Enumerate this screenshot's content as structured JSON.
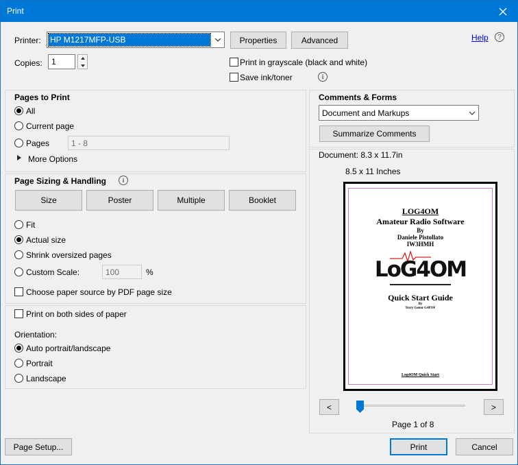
{
  "window": {
    "title": "Print"
  },
  "printer": {
    "label": "Printer:",
    "selected": "HP M1217MFP-USB",
    "properties_label": "Properties",
    "advanced_label": "Advanced",
    "help_label": "Help",
    "copies_label": "Copies:",
    "copies_value": "1",
    "grayscale_label": "Print in grayscale (black and white)",
    "grayscale_checked": false,
    "save_ink_label": "Save ink/toner",
    "save_ink_checked": false
  },
  "pages_to_print": {
    "heading": "Pages to Print",
    "all_label": "All",
    "current_label": "Current page",
    "pages_label": "Pages",
    "pages_value": "1 - 8",
    "more_options_label": "More Options",
    "selected": "All"
  },
  "sizing": {
    "heading": "Page Sizing & Handling",
    "tabs": [
      {
        "label": "Size"
      },
      {
        "label": "Poster"
      },
      {
        "label": "Multiple"
      },
      {
        "label": "Booklet"
      }
    ],
    "fit_label": "Fit",
    "actual_label": "Actual size",
    "shrink_label": "Shrink oversized pages",
    "custom_label": "Custom Scale:",
    "custom_value": "100",
    "percent": "%",
    "paper_source_label": "Choose paper source by PDF page size",
    "selected": "Actual size"
  },
  "duplex": {
    "both_sides_label": "Print on both sides of paper",
    "orientation_label": "Orientation:",
    "auto_label": "Auto portrait/landscape",
    "portrait_label": "Portrait",
    "landscape_label": "Landscape",
    "selected": "Auto portrait/landscape"
  },
  "comments": {
    "heading": "Comments & Forms",
    "selected": "Document and Markups",
    "summarize_label": "Summarize Comments"
  },
  "preview": {
    "document_size": "Document: 8.3 x 11.7in",
    "paper_size": "8.5 x 11 Inches",
    "page_indicator": "Page 1 of 8",
    "prev_label": "<",
    "next_label": ">",
    "slider_position": 0.0,
    "doc": {
      "title": "LOG4OM",
      "subtitle": "Amateur Radio Software",
      "by": "By",
      "author": "Daniele Pistollato",
      "callsign": "IW3HMH",
      "logo": "LoG4OM",
      "guide_title": "Quick Start Guide",
      "by2": "By",
      "guide_author": "Terry Gener G4POF",
      "footer": "Log4OM Quick Start"
    }
  },
  "footer": {
    "page_setup_label": "Page Setup...",
    "print_label": "Print",
    "cancel_label": "Cancel"
  },
  "colors": {
    "titlebar": "#0078d7",
    "accent": "#0078d7",
    "link": "#0000ee"
  }
}
